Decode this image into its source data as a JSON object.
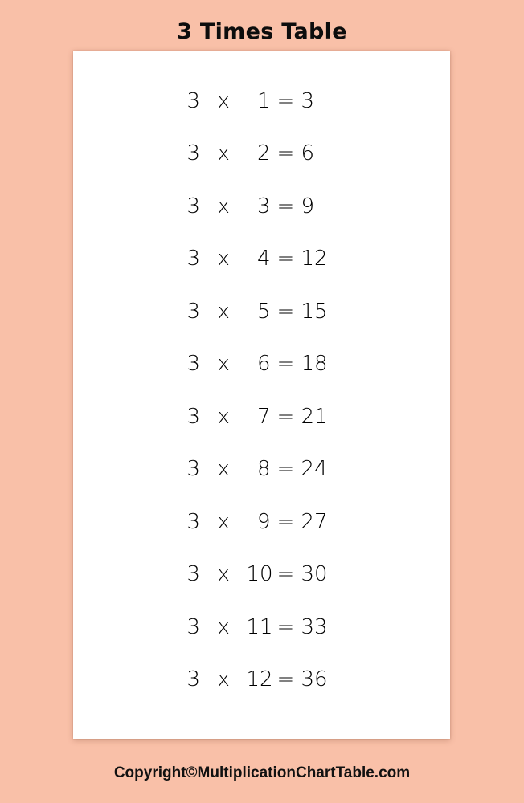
{
  "title": "3 Times Table",
  "colors": {
    "background": "#f9c0a8",
    "card": "#ffffff",
    "title_text": "#0d0d0d",
    "equation_text": "#000000",
    "footer_text": "#111111"
  },
  "table": {
    "multiplicand": "3",
    "operator": "x",
    "equals": "=",
    "rows": [
      {
        "a": "3",
        "op": "x",
        "b": "1",
        "eq": "=",
        "product": "3"
      },
      {
        "a": "3",
        "op": "x",
        "b": "2",
        "eq": "=",
        "product": "6"
      },
      {
        "a": "3",
        "op": "x",
        "b": "3",
        "eq": "=",
        "product": "9"
      },
      {
        "a": "3",
        "op": "x",
        "b": "4",
        "eq": "=",
        "product": "12"
      },
      {
        "a": "3",
        "op": "x",
        "b": "5",
        "eq": "=",
        "product": "15"
      },
      {
        "a": "3",
        "op": "x",
        "b": "6",
        "eq": "=",
        "product": "18"
      },
      {
        "a": "3",
        "op": "x",
        "b": "7",
        "eq": "=",
        "product": "21"
      },
      {
        "a": "3",
        "op": "x",
        "b": "8",
        "eq": "=",
        "product": "24"
      },
      {
        "a": "3",
        "op": "x",
        "b": "9",
        "eq": "=",
        "product": "27"
      },
      {
        "a": "3",
        "op": "x",
        "b": "10",
        "eq": "=",
        "product": "30"
      },
      {
        "a": "3",
        "op": "x",
        "b": "11",
        "eq": "=",
        "product": "33"
      },
      {
        "a": "3",
        "op": "x",
        "b": "12",
        "eq": "=",
        "product": "36"
      }
    ]
  },
  "footer": {
    "copyright": "Copyright©MultiplicationChartTable.com"
  }
}
